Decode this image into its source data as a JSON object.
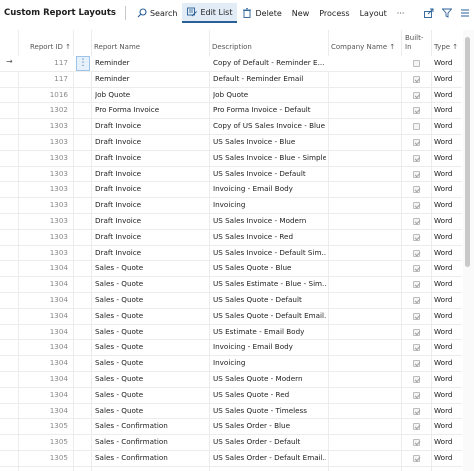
{
  "toolbar": {
    "title": "Custom Report Layouts",
    "search": "Search",
    "edit_list": "Edit List",
    "delete": "Delete",
    "new": "New",
    "process": "Process",
    "layout": "Layout",
    "more": "···"
  },
  "headers": {
    "report_id": "Report ID ↑",
    "report_name": "Report Name",
    "description": "Description",
    "company_name": "Company Name ↑",
    "built_in_1": "Built-",
    "built_in_2": "In",
    "type": "Type ↑"
  },
  "rows": [
    {
      "id": "117",
      "name": "Reminder",
      "desc": "Copy of Default - Reminder E...",
      "built_in": false,
      "type": "Word"
    },
    {
      "id": "117",
      "name": "Reminder",
      "desc": "Default - Reminder Email",
      "built_in": true,
      "type": "Word"
    },
    {
      "id": "1016",
      "name": "Job Quote",
      "desc": "Job Quote",
      "built_in": true,
      "type": "Word"
    },
    {
      "id": "1302",
      "name": "Pro Forma Invoice",
      "desc": "Pro Forma Invoice - Default",
      "built_in": true,
      "type": "Word"
    },
    {
      "id": "1303",
      "name": "Draft Invoice",
      "desc": "Copy of US Sales Invoice - Blue",
      "built_in": false,
      "type": "Word"
    },
    {
      "id": "1303",
      "name": "Draft Invoice",
      "desc": "US Sales Invoice - Blue",
      "built_in": true,
      "type": "Word"
    },
    {
      "id": "1303",
      "name": "Draft Invoice",
      "desc": "US Sales Invoice - Blue - Simple",
      "built_in": true,
      "type": "Word"
    },
    {
      "id": "1303",
      "name": "Draft Invoice",
      "desc": "US Sales Invoice - Default",
      "built_in": true,
      "type": "Word"
    },
    {
      "id": "1303",
      "name": "Draft Invoice",
      "desc": "Invoicing - Email Body",
      "built_in": true,
      "type": "Word"
    },
    {
      "id": "1303",
      "name": "Draft Invoice",
      "desc": "Invoicing",
      "built_in": true,
      "type": "Word"
    },
    {
      "id": "1303",
      "name": "Draft Invoice",
      "desc": "US Sales Invoice - Modern",
      "built_in": true,
      "type": "Word"
    },
    {
      "id": "1303",
      "name": "Draft Invoice",
      "desc": "US Sales Invoice - Red",
      "built_in": true,
      "type": "Word"
    },
    {
      "id": "1303",
      "name": "Draft Invoice",
      "desc": "US Sales Invoice - Default Sim...",
      "built_in": true,
      "type": "Word"
    },
    {
      "id": "1304",
      "name": "Sales - Quote",
      "desc": "US Sales Quote - Blue",
      "built_in": true,
      "type": "Word"
    },
    {
      "id": "1304",
      "name": "Sales - Quote",
      "desc": "US Sales Estimate - Blue - Sim...",
      "built_in": true,
      "type": "Word"
    },
    {
      "id": "1304",
      "name": "Sales - Quote",
      "desc": "US Sales Quote - Default",
      "built_in": true,
      "type": "Word"
    },
    {
      "id": "1304",
      "name": "Sales - Quote",
      "desc": "US Sales Quote - Default Email...",
      "built_in": true,
      "type": "Word"
    },
    {
      "id": "1304",
      "name": "Sales - Quote",
      "desc": "US Estimate - Email Body",
      "built_in": true,
      "type": "Word"
    },
    {
      "id": "1304",
      "name": "Sales - Quote",
      "desc": "Invoicing - Email Body",
      "built_in": true,
      "type": "Word"
    },
    {
      "id": "1304",
      "name": "Sales - Quote",
      "desc": "Invoicing",
      "built_in": true,
      "type": "Word"
    },
    {
      "id": "1304",
      "name": "Sales - Quote",
      "desc": "US Sales Quote - Modern",
      "built_in": true,
      "type": "Word"
    },
    {
      "id": "1304",
      "name": "Sales - Quote",
      "desc": "US Sales Quote - Red",
      "built_in": true,
      "type": "Word"
    },
    {
      "id": "1304",
      "name": "Sales - Quote",
      "desc": "US Sales Quote - Timeless",
      "built_in": true,
      "type": "Word"
    },
    {
      "id": "1305",
      "name": "Sales - Confirmation",
      "desc": "US Sales Order - Blue",
      "built_in": true,
      "type": "Word"
    },
    {
      "id": "1305",
      "name": "Sales - Confirmation",
      "desc": "US Sales Order - Default",
      "built_in": true,
      "type": "Word"
    },
    {
      "id": "1305",
      "name": "Sales - Confirmation",
      "desc": "US Sales Order - Default Email...",
      "built_in": true,
      "type": "Word"
    }
  ]
}
